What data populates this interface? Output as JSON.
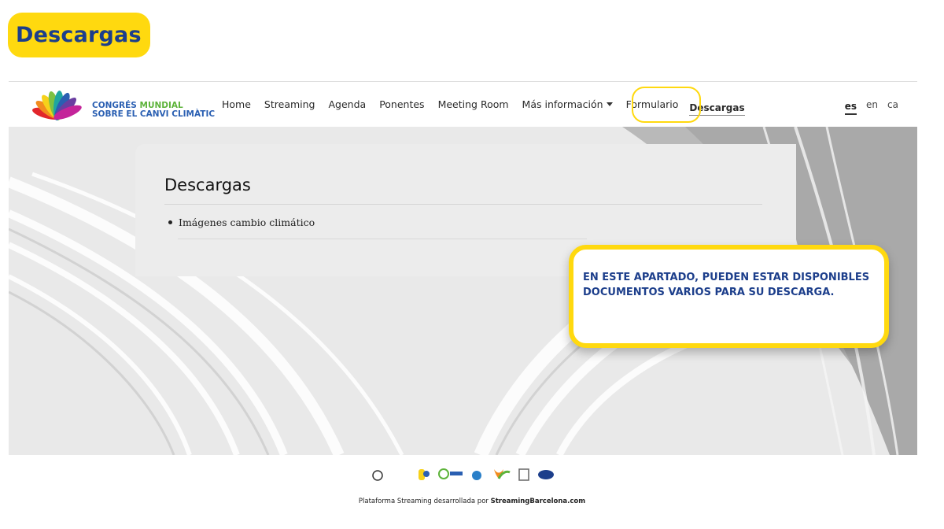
{
  "banner": {
    "title": "Descargas"
  },
  "logo": {
    "line1a": "CONGRÉS ",
    "line1b": "MUNDIAL",
    "line2": "SOBRE EL CANVI CLIMÀTIC"
  },
  "nav": {
    "items": [
      "Home",
      "Streaming",
      "Agenda",
      "Ponentes",
      "Meeting Room",
      "Más información",
      "Formulario"
    ],
    "active": "Descargas"
  },
  "languages": {
    "active": "es",
    "others": [
      "en",
      "ca"
    ]
  },
  "content": {
    "heading": "Descargas",
    "list": [
      "Imágenes cambio climático"
    ]
  },
  "callout": {
    "text": "EN ESTE APARTADO, PUEDEN ESTAR DISPONIBLES DOCUMENTOS VARIOS PARA SU DESCARGA."
  },
  "footer": {
    "prefix": "Plataforma Streaming desarrollada por ",
    "brand": "StreamingBarcelona.com"
  },
  "colors": {
    "accent_yellow": "#ffd90f",
    "brand_blue": "#1c3e8b"
  }
}
